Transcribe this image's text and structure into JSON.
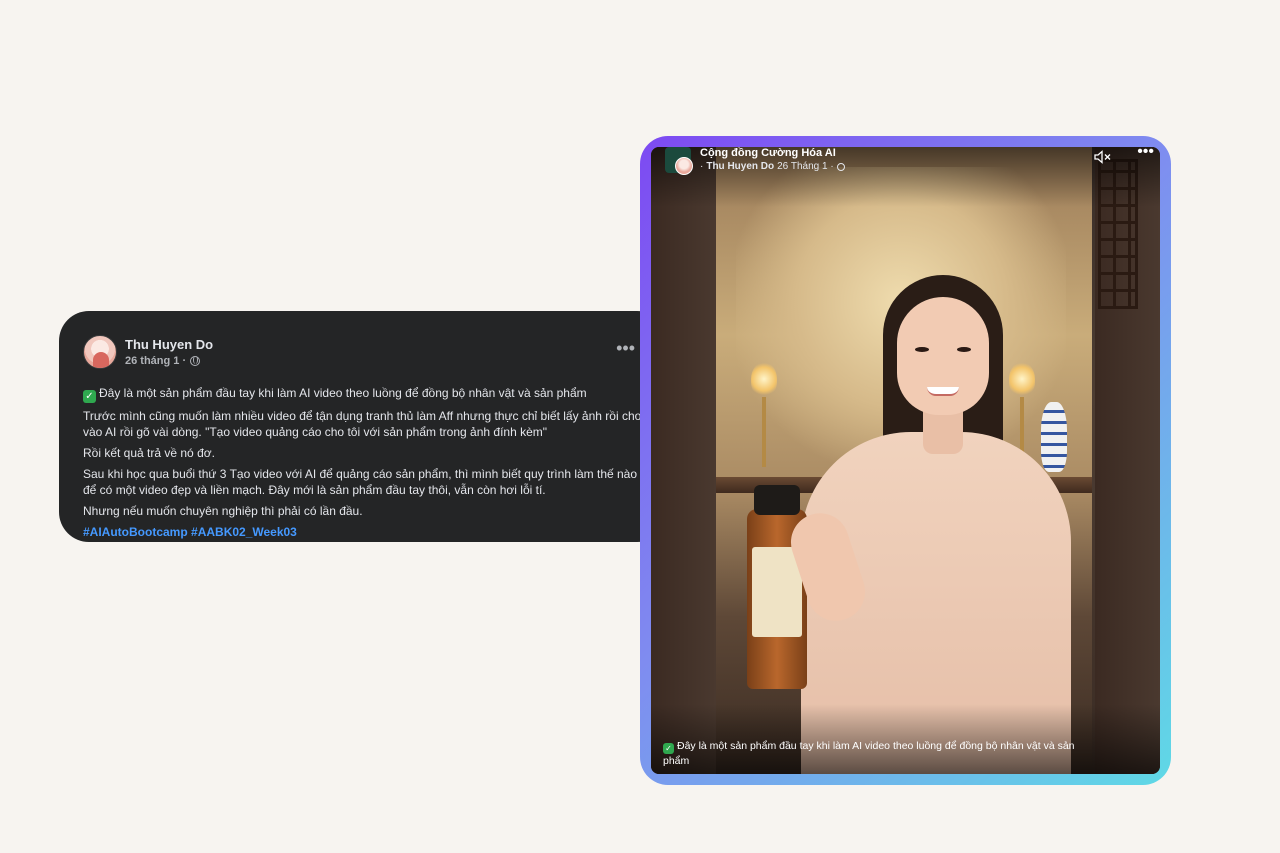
{
  "post": {
    "author": "Thu Huyen Do",
    "date": "26 tháng 1 ·",
    "privacy_icon": "globe-icon",
    "more_label": "•••",
    "check_emoji": "✓",
    "paragraphs": [
      "Đây là một sản phẩm đầu tay khi làm AI video theo luồng để đồng bộ nhân vật và sản phẩm",
      "Trước mình cũng muốn làm nhiều video để tận dụng tranh thủ làm Aff nhưng thực chỉ biết lấy ảnh rồi cho vào AI rồi gõ vài dòng. \"Tạo video quảng cáo cho tôi với sản phẩm trong ảnh đính kèm\"",
      "Rồi kết quả trả về nó đơ.",
      "Sau khi học qua buổi thứ 3 Tạo video với AI để quảng cáo sản phẩm, thì mình biết quy trình làm thế nào để có một video đẹp và liền mạch. Đây mới là sản phẩm đầu tay thôi, vẫn còn hơi lỗi tí.",
      "Nhưng nếu muốn chuyên nghiệp thì phải có lần đầu."
    ],
    "hashtags": [
      "#AIAutoBootcamp",
      "#AABK02_Week03"
    ]
  },
  "video": {
    "group_name": "Cộng đồng Cường Hóa AI",
    "author_prefix": "·",
    "author": "Thu Huyen Do",
    "date": "26 Tháng 1 ·",
    "mute_icon": "speaker-muted-icon",
    "more_label": "•••",
    "caption": "Đây là một sản phẩm đầu tay khi làm AI video theo luồng để đồng bộ nhân vật và sản phẩm"
  },
  "colors": {
    "card_bg": "#242526",
    "hashtag": "#4599ff",
    "frame_gradient_start": "#7d49f2",
    "frame_gradient_end": "#5fd9e6",
    "page_bg": "#f7f4f0"
  }
}
